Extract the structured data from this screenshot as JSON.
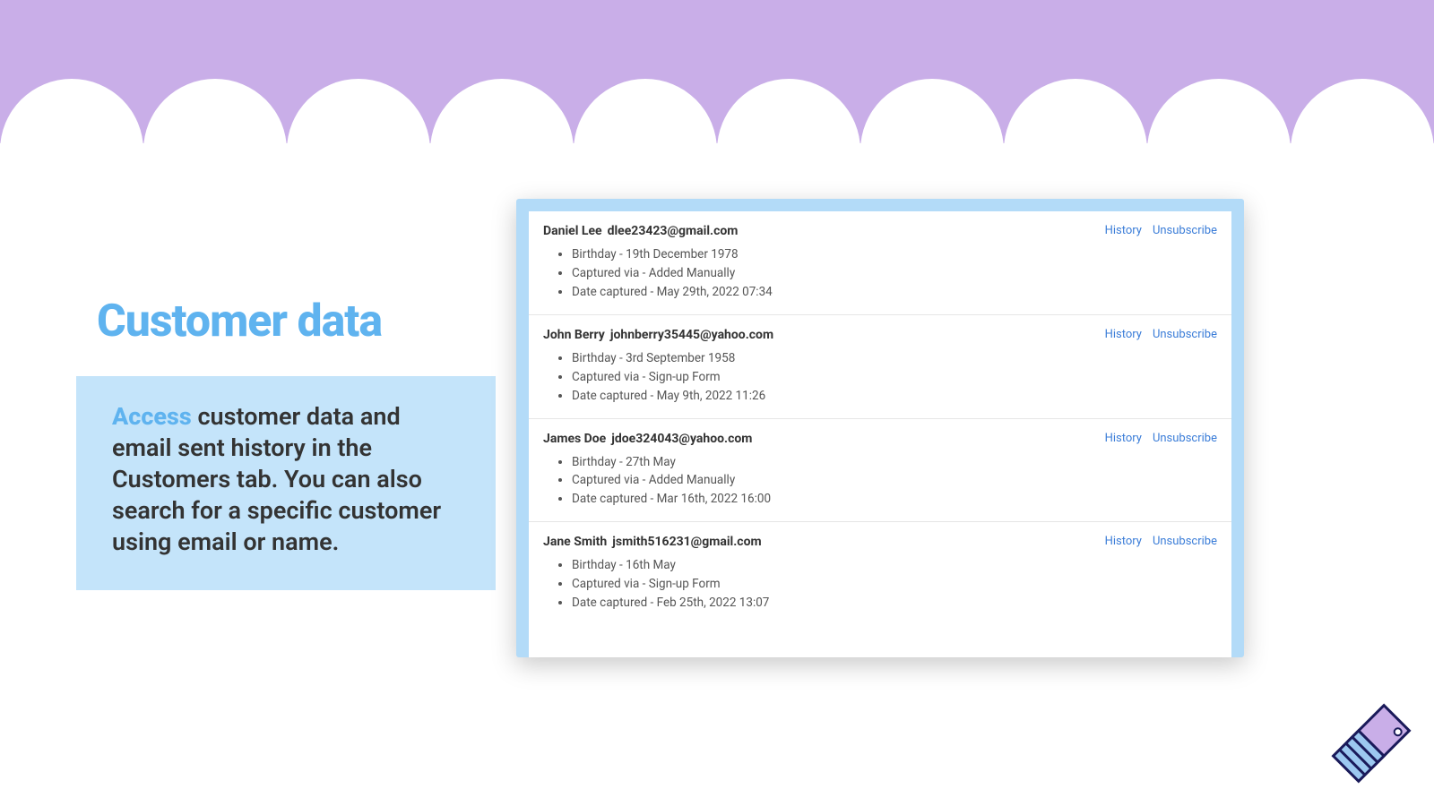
{
  "heading": "Customer data",
  "description_lead": "Access",
  "description_rest": " customer data and email sent history in the Customers tab. You can also search for a specific customer using email or name.",
  "actions": {
    "history": "History",
    "unsubscribe": "Unsubscribe"
  },
  "labels": {
    "birthday": "Birthday - ",
    "captured_via": "Captured via - ",
    "date_captured": "Date captured - "
  },
  "customers": [
    {
      "name": "Daniel Lee",
      "email": "dlee23423@gmail.com",
      "birthday": "19th December 1978",
      "captured_via": "Added Manually",
      "date_captured": "May 29th, 2022 07:34"
    },
    {
      "name": "John Berry",
      "email": "johnberry35445@yahoo.com",
      "birthday": "3rd September 1958",
      "captured_via": "Sign-up Form",
      "date_captured": "May 9th, 2022 11:26"
    },
    {
      "name": "James Doe",
      "email": "jdoe324043@yahoo.com",
      "birthday": "27th May",
      "captured_via": "Added Manually",
      "date_captured": "Mar 16th, 2022 16:00"
    },
    {
      "name": "Jane Smith",
      "email": "jsmith516231@gmail.com",
      "birthday": "16th May",
      "captured_via": "Sign-up Form",
      "date_captured": "Feb 25th, 2022 13:07"
    }
  ]
}
